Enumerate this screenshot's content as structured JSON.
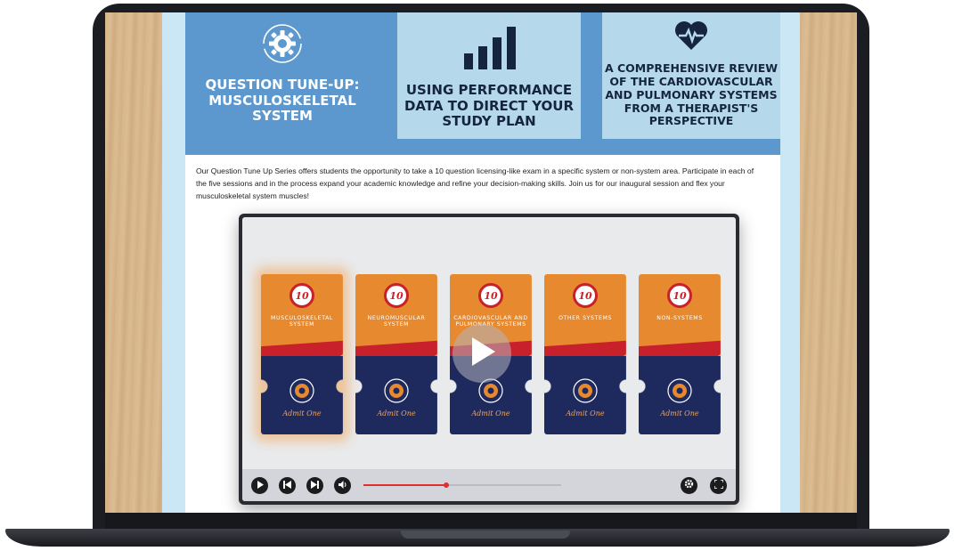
{
  "header": {
    "cards": [
      {
        "title": "Question Tune-Up: Musculoskeletal System",
        "icon": "gear-icon"
      },
      {
        "title": "Using Performance Data to Direct Your Study Plan",
        "icon": "bar-chart-icon"
      },
      {
        "title": "A Comprehensive Review of the Cardiovascular and Pulmonary Systems from a Therapist's Perspective",
        "icon": "heartbeat-icon"
      }
    ]
  },
  "description": "Our Question Tune Up Series offers students the opportunity to take a 10 question licensing-like exam in a specific system or non-system area. Participate in each of the five sessions and in the process expand your academic knowledge and refine your decision-making skills. Join us for our inaugural session and flex your musculoskeletal system muscles!",
  "video": {
    "tickets": [
      {
        "number": "10",
        "label": "MUSCULOSKELETAL SYSTEM",
        "admit": "Admit One"
      },
      {
        "number": "10",
        "label": "NEUROMUSCULAR SYSTEM",
        "admit": "Admit One"
      },
      {
        "number": "10",
        "label": "CARDIOVASCULAR AND PULMONARY SYSTEMS",
        "admit": "Admit One"
      },
      {
        "number": "10",
        "label": "OTHER SYSTEMS",
        "admit": "Admit One"
      },
      {
        "number": "10",
        "label": "NON-SYSTEMS",
        "admit": "Admit One"
      }
    ],
    "progress_fraction": 0.42
  },
  "colors": {
    "brand_blue": "#5c98cd",
    "light_blue": "#b5d9ea",
    "navy": "#1e2a5e",
    "orange": "#e78a2f",
    "red": "#c8212b",
    "progress_red": "#e02f2f"
  }
}
